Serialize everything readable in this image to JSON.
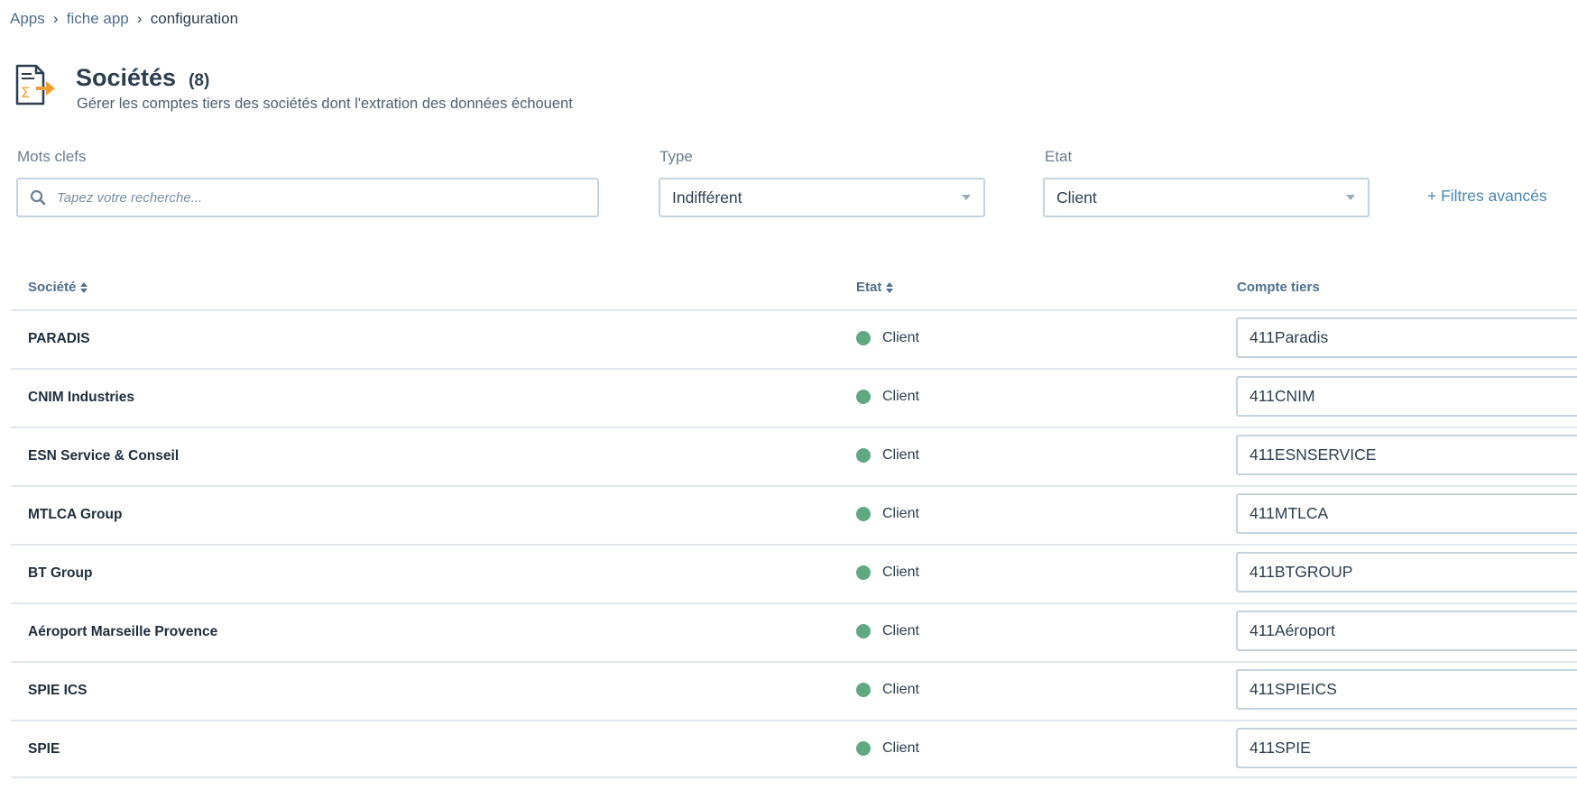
{
  "breadcrumb": {
    "items": [
      {
        "label": "Apps"
      },
      {
        "label": "fiche app"
      }
    ],
    "current": "configuration"
  },
  "header": {
    "icon": "document-sum-export-icon",
    "title": "Sociétés",
    "count": "(8)",
    "subtitle": "Gérer les comptes tiers des sociétés dont l'extration des données échouent"
  },
  "filters": {
    "keywords": {
      "label": "Mots clefs",
      "placeholder": "Tapez votre recherche...",
      "value": ""
    },
    "type": {
      "label": "Type",
      "value": "Indifférent"
    },
    "etat": {
      "label": "Etat",
      "value": "Client"
    },
    "advanced_label": "+ Filtres avancés"
  },
  "table": {
    "columns": {
      "societe": "Société",
      "etat": "Etat",
      "compte": "Compte tiers"
    },
    "rows": [
      {
        "societe": "PARADIS",
        "etat": "Client",
        "compte": "411Paradis"
      },
      {
        "societe": "CNIM Industries",
        "etat": "Client",
        "compte": "411CNIM"
      },
      {
        "societe": "ESN Service & Conseil",
        "etat": "Client",
        "compte": "411ESNSERVICE"
      },
      {
        "societe": "MTLCA Group",
        "etat": "Client",
        "compte": "411MTLCA"
      },
      {
        "societe": "BT Group",
        "etat": "Client",
        "compte": "411BTGROUP"
      },
      {
        "societe": "Aéroport Marseille Provence",
        "etat": "Client",
        "compte": "411Aéroport"
      },
      {
        "societe": "SPIE ICS",
        "etat": "Client",
        "compte": "411SPIEICS"
      },
      {
        "societe": "SPIE",
        "etat": "Client",
        "compte": "411SPIE"
      }
    ]
  },
  "colors": {
    "accent": "#4c86b3",
    "status_client": "#5fa882",
    "icon_orange": "#f0a030"
  }
}
